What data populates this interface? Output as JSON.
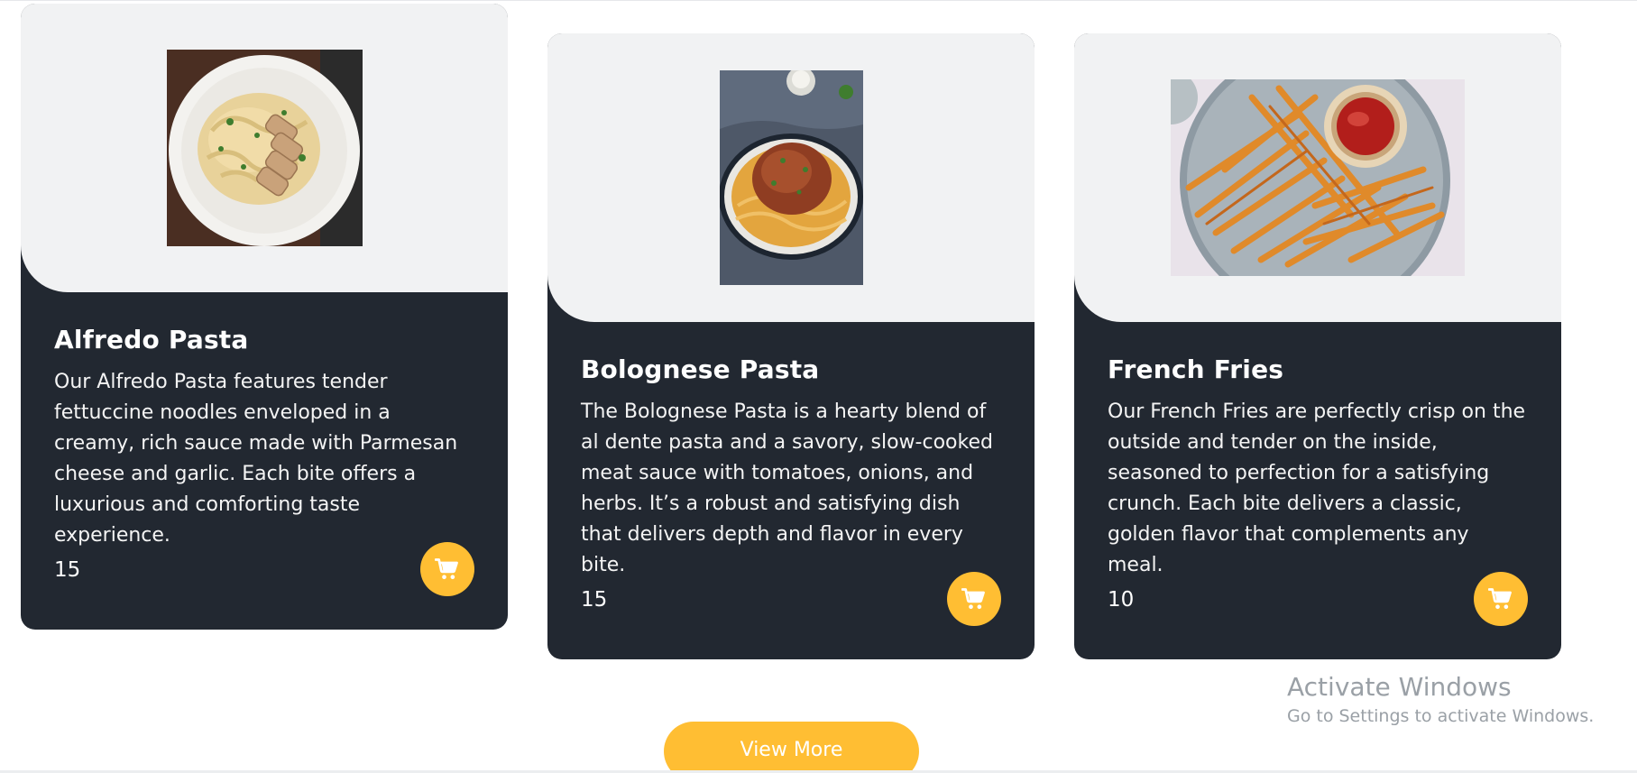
{
  "menu": {
    "items": [
      {
        "title": "Alfredo Pasta",
        "description": "Our Alfredo Pasta features tender fettuccine noodles enveloped in a creamy, rich sauce made with Parmesan cheese and garlic. Each bite offers a luxurious and comforting taste experience.",
        "price": "15",
        "image_icon": "alfredo-pasta-image",
        "cart_icon": "cart-icon"
      },
      {
        "title": "Bolognese Pasta",
        "description": "The Bolognese Pasta is a hearty blend of al dente pasta and a savory, slow-cooked meat sauce with tomatoes, onions, and herbs. It’s a robust and satisfying dish that delivers depth and flavor in every bite.",
        "price": "15",
        "image_icon": "bolognese-pasta-image",
        "cart_icon": "cart-icon"
      },
      {
        "title": "French Fries",
        "description": "Our French Fries are perfectly crisp on the outside and tender on the inside, seasoned to perfection for a satisfying crunch. Each bite delivers a classic, golden flavor that complements any meal.",
        "price": "10",
        "image_icon": "french-fries-image",
        "cart_icon": "cart-icon"
      }
    ],
    "view_more_label": "View More"
  },
  "watermark": {
    "title": "Activate Windows",
    "subtitle": "Go to Settings to activate Windows."
  },
  "colors": {
    "card_dark": "#222831",
    "card_light": "#f1f2f3",
    "accent": "#ffbe33",
    "text_light": "#ffffff"
  }
}
